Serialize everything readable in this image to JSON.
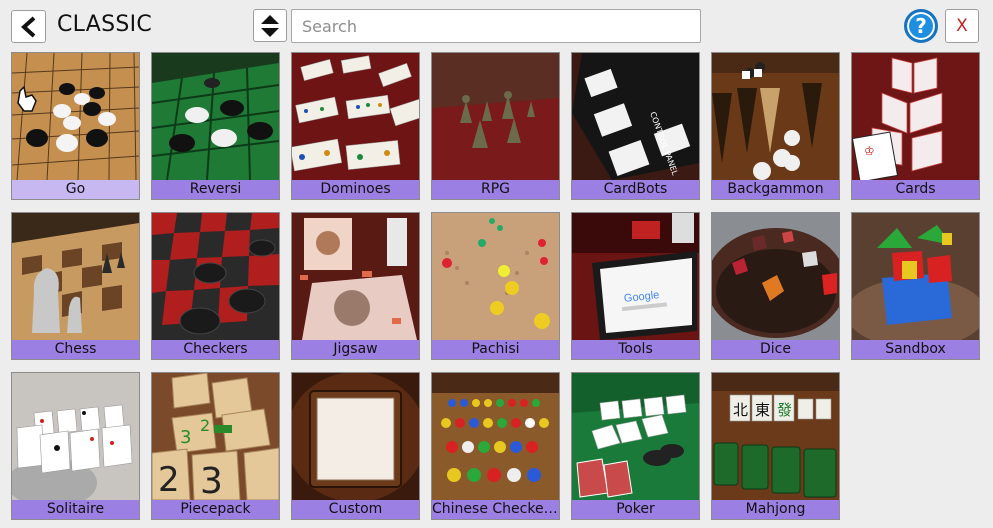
{
  "header": {
    "title": "CLASSIC",
    "back_icon": "chevron-left-icon",
    "sort_icon": "sort-updown-icon",
    "help_icon": "help-circle-icon",
    "close_label": "X"
  },
  "search": {
    "placeholder": "Search",
    "value": ""
  },
  "colors": {
    "label_bg": "#9b7fe3",
    "label_bg_selected": "#c8b8f2",
    "help_blue": "#1e8fe0",
    "close_red": "#c62020"
  },
  "games": [
    {
      "label": "Go",
      "selected": true
    },
    {
      "label": "Reversi"
    },
    {
      "label": "Dominoes"
    },
    {
      "label": "RPG"
    },
    {
      "label": "CardBots"
    },
    {
      "label": "Backgammon"
    },
    {
      "label": "Cards"
    },
    {
      "label": "Chess"
    },
    {
      "label": "Checkers"
    },
    {
      "label": "Jigsaw"
    },
    {
      "label": "Pachisi"
    },
    {
      "label": "Tools"
    },
    {
      "label": "Dice"
    },
    {
      "label": "Sandbox"
    },
    {
      "label": "Solitaire"
    },
    {
      "label": "Piecepack"
    },
    {
      "label": "Custom"
    },
    {
      "label": "Chinese Checker..."
    },
    {
      "label": "Poker"
    },
    {
      "label": "Mahjong"
    }
  ],
  "thumb_text": {
    "cardbots": "CONTROL PANEL",
    "google": "Google",
    "piecepack": [
      "2",
      "3",
      "2",
      "3",
      "2"
    ],
    "mahjong": [
      "北",
      "東",
      "發"
    ]
  }
}
